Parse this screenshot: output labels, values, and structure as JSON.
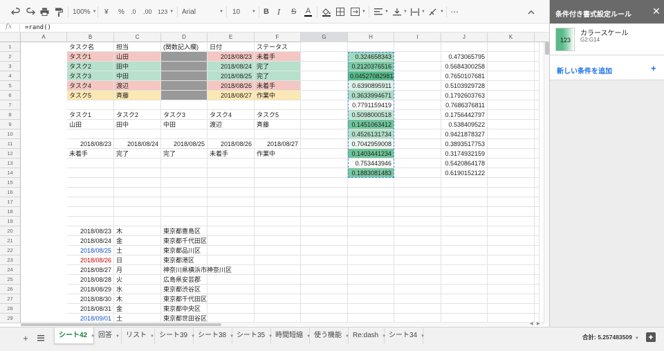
{
  "toolbar": {
    "zoom": "100%",
    "currency": "¥",
    "percent": "%",
    "decimal_decrease": ".0",
    "decimal_increase": ".00",
    "number_format": "123",
    "font": "Arial",
    "font_size": "10",
    "bold": "B",
    "italic": "I",
    "strike": "S",
    "text_color_letter": "A",
    "more": "⋯"
  },
  "formula_bar": {
    "fx": "fx",
    "formula": "=rand()"
  },
  "columns": [
    "A",
    "B",
    "C",
    "D",
    "E",
    "F",
    "G",
    "H",
    "I",
    "J",
    "K"
  ],
  "rows": [
    {
      "n": "1",
      "cells": [
        {
          "c": 0,
          "t": "タスク名"
        },
        {
          "c": 1,
          "t": "担当"
        },
        {
          "c": 2,
          "t": "(関数記入欄)"
        },
        {
          "c": 3,
          "t": "日付"
        },
        {
          "c": 4,
          "t": "ステータス"
        }
      ]
    },
    {
      "n": "2",
      "cells": [
        {
          "c": 0,
          "t": "タスク1",
          "bg": "red"
        },
        {
          "c": 1,
          "t": "山田",
          "bg": "red"
        },
        {
          "c": 2,
          "t": "",
          "bg": "gray"
        },
        {
          "c": 3,
          "t": "2018/08/23",
          "bg": "red",
          "num": true
        },
        {
          "c": 4,
          "t": "未着手",
          "bg": "red"
        },
        {
          "c": 6,
          "t": "0.324658343",
          "num": true,
          "g": 0.56
        },
        {
          "c": 8,
          "t": "0.473065795",
          "num": true
        }
      ]
    },
    {
      "n": "3",
      "cells": [
        {
          "c": 0,
          "t": "タスク2",
          "bg": "green"
        },
        {
          "c": 1,
          "t": "田中",
          "bg": "green"
        },
        {
          "c": 2,
          "t": "",
          "bg": "gray"
        },
        {
          "c": 3,
          "t": "2018/08/24",
          "bg": "green",
          "num": true
        },
        {
          "c": 4,
          "t": "完了",
          "bg": "green"
        },
        {
          "c": 6,
          "t": "0.2120376516",
          "num": true,
          "g": 0.77
        },
        {
          "c": 8,
          "t": "0.5684300258",
          "num": true
        }
      ]
    },
    {
      "n": "4",
      "cells": [
        {
          "c": 0,
          "t": "タスク3",
          "bg": "green"
        },
        {
          "c": 1,
          "t": "中田",
          "bg": "green"
        },
        {
          "c": 2,
          "t": "",
          "bg": "gray"
        },
        {
          "c": 3,
          "t": "2018/08/25",
          "bg": "green",
          "num": true
        },
        {
          "c": 4,
          "t": "完了",
          "bg": "green"
        },
        {
          "c": 6,
          "t": "0.04527082981",
          "num": true,
          "g": 1.0
        },
        {
          "c": 8,
          "t": "0.7650107681",
          "num": true
        }
      ]
    },
    {
      "n": "5",
      "cells": [
        {
          "c": 0,
          "t": "タスク4",
          "bg": "red"
        },
        {
          "c": 1,
          "t": "渡辺",
          "bg": "red"
        },
        {
          "c": 2,
          "t": "",
          "bg": "gray"
        },
        {
          "c": 3,
          "t": "2018/08/26",
          "bg": "red",
          "num": true
        },
        {
          "c": 4,
          "t": "未着手",
          "bg": "red"
        },
        {
          "c": 6,
          "t": "0.6390895911",
          "num": true,
          "g": 0.2
        },
        {
          "c": 8,
          "t": "0.5103929728",
          "num": true
        }
      ]
    },
    {
      "n": "6",
      "cells": [
        {
          "c": 0,
          "t": "タスク5",
          "bg": "yellow"
        },
        {
          "c": 1,
          "t": "斉藤",
          "bg": "yellow"
        },
        {
          "c": 2,
          "t": "",
          "bg": "gray"
        },
        {
          "c": 3,
          "t": "2018/08/27",
          "bg": "yellow",
          "num": true
        },
        {
          "c": 4,
          "t": "作業中",
          "bg": "yellow"
        },
        {
          "c": 6,
          "t": "0.3633994671",
          "num": true,
          "g": 0.5
        },
        {
          "c": 8,
          "t": "0.1792603763",
          "num": true
        }
      ]
    },
    {
      "n": "7",
      "cells": [
        {
          "c": 6,
          "t": "0.7791159419",
          "num": true,
          "g": 0.0
        },
        {
          "c": 8,
          "t": "0.7686376811",
          "num": true
        }
      ]
    },
    {
      "n": "8",
      "cells": [
        {
          "c": 0,
          "t": "タスク1"
        },
        {
          "c": 1,
          "t": "タスク2"
        },
        {
          "c": 2,
          "t": "タスク3"
        },
        {
          "c": 3,
          "t": "タスク4"
        },
        {
          "c": 4,
          "t": "タスク5"
        },
        {
          "c": 6,
          "t": "0.5098000518",
          "num": true,
          "g": 0.37
        },
        {
          "c": 8,
          "t": "0.1756442797",
          "num": true
        }
      ]
    },
    {
      "n": "9",
      "cells": [
        {
          "c": 0,
          "t": "山田"
        },
        {
          "c": 1,
          "t": "田中"
        },
        {
          "c": 2,
          "t": "中田"
        },
        {
          "c": 3,
          "t": "渡辺"
        },
        {
          "c": 4,
          "t": "斉藤"
        },
        {
          "c": 6,
          "t": "0.1451063412",
          "num": true,
          "g": 0.86
        },
        {
          "c": 8,
          "t": "0.538409522",
          "num": true
        }
      ]
    },
    {
      "n": "10",
      "cells": [
        {
          "c": 6,
          "t": "0.4526131734",
          "num": true,
          "g": 0.45
        },
        {
          "c": 8,
          "t": "0.9421878327",
          "num": true
        }
      ]
    },
    {
      "n": "11",
      "cells": [
        {
          "c": 0,
          "t": "2018/08/23",
          "num": true
        },
        {
          "c": 1,
          "t": "2018/08/24",
          "num": true
        },
        {
          "c": 2,
          "t": "2018/08/25",
          "num": true
        },
        {
          "c": 3,
          "t": "2018/08/26",
          "num": true
        },
        {
          "c": 4,
          "t": "2018/08/27",
          "num": true
        },
        {
          "c": 6,
          "t": "0.7042959008",
          "num": true,
          "g": 0.1
        },
        {
          "c": 8,
          "t": "0.3893517753",
          "num": true
        }
      ]
    },
    {
      "n": "12",
      "cells": [
        {
          "c": 0,
          "t": "未着手"
        },
        {
          "c": 1,
          "t": "完了"
        },
        {
          "c": 2,
          "t": "完了"
        },
        {
          "c": 3,
          "t": "未着手"
        },
        {
          "c": 4,
          "t": "作業中"
        },
        {
          "c": 6,
          "t": "0.1403441234",
          "num": true,
          "g": 0.87
        },
        {
          "c": 8,
          "t": "0.3174932159",
          "num": true
        }
      ]
    },
    {
      "n": "13",
      "cells": [
        {
          "c": 6,
          "t": "0.753443946",
          "num": true,
          "g": 0.03
        },
        {
          "c": 8,
          "t": "0.5420864178",
          "num": true
        }
      ]
    },
    {
      "n": "14",
      "cells": [
        {
          "c": 6,
          "t": "0.1883081483",
          "num": true,
          "g": 0.8
        },
        {
          "c": 8,
          "t": "0.6190152122",
          "num": true
        }
      ]
    },
    {
      "n": "15",
      "cells": []
    },
    {
      "n": "16",
      "cells": []
    },
    {
      "n": "17",
      "cells": []
    },
    {
      "n": "18",
      "cells": []
    },
    {
      "n": "19",
      "cells": []
    },
    {
      "n": "20",
      "cells": [
        {
          "c": 0,
          "t": "2018/08/23",
          "num": true
        },
        {
          "c": 1,
          "t": "木"
        },
        {
          "c": 2,
          "t": "東京都豊島区"
        }
      ]
    },
    {
      "n": "21",
      "cells": [
        {
          "c": 0,
          "t": "2018/08/24",
          "num": true
        },
        {
          "c": 1,
          "t": "金"
        },
        {
          "c": 2,
          "t": "東京都千代田区"
        }
      ]
    },
    {
      "n": "22",
      "cells": [
        {
          "c": 0,
          "t": "2018/08/25",
          "num": true,
          "fg": "blue"
        },
        {
          "c": 1,
          "t": "土"
        },
        {
          "c": 2,
          "t": "東京都品川区"
        }
      ]
    },
    {
      "n": "23",
      "cells": [
        {
          "c": 0,
          "t": "2018/08/26",
          "num": true,
          "fg": "red"
        },
        {
          "c": 1,
          "t": "日"
        },
        {
          "c": 2,
          "t": "東京都港区"
        }
      ]
    },
    {
      "n": "24",
      "cells": [
        {
          "c": 0,
          "t": "2018/08/27",
          "num": true
        },
        {
          "c": 1,
          "t": "月"
        },
        {
          "c": 2,
          "t": "神奈川県横浜市神奈川区"
        }
      ]
    },
    {
      "n": "25",
      "cells": [
        {
          "c": 0,
          "t": "2018/08/28",
          "num": true
        },
        {
          "c": 1,
          "t": "火"
        },
        {
          "c": 2,
          "t": "広島県安芸郡"
        }
      ]
    },
    {
      "n": "26",
      "cells": [
        {
          "c": 0,
          "t": "2018/08/29",
          "num": true
        },
        {
          "c": 1,
          "t": "水"
        },
        {
          "c": 2,
          "t": "東京都渋谷区"
        }
      ]
    },
    {
      "n": "27",
      "cells": [
        {
          "c": 0,
          "t": "2018/08/30",
          "num": true
        },
        {
          "c": 1,
          "t": "木"
        },
        {
          "c": 2,
          "t": "東京都千代田区"
        }
      ]
    },
    {
      "n": "28",
      "cells": [
        {
          "c": 0,
          "t": "2018/08/31",
          "num": true
        },
        {
          "c": 1,
          "t": "金"
        },
        {
          "c": 2,
          "t": "東京都中央区"
        }
      ]
    },
    {
      "n": "29",
      "cells": [
        {
          "c": 0,
          "t": "2018/09/01",
          "num": true,
          "fg": "blue"
        },
        {
          "c": 1,
          "t": "土"
        },
        {
          "c": 2,
          "t": "東京都世田谷区"
        }
      ]
    }
  ],
  "colors": {
    "red": "#f4c7c3",
    "green": "#b7e1cd",
    "yellow": "#fce8b2",
    "gray": "#999999",
    "blue_text": "#1155cc",
    "red_text": "#cc0000",
    "scale_min": "#57bb8a",
    "scale_max": "#ffffff",
    "selection": "#4285f4",
    "active_tab": "#188038",
    "link": "#1a73e8"
  },
  "tabs": [
    "シート42",
    "回答",
    "リスト",
    "シート39",
    "シート38",
    "シート35",
    "時間短縮",
    "使う機能",
    "Re:dash",
    "シート34"
  ],
  "active_tab": "シート42",
  "status": {
    "sum": "合計: 5.257483509"
  },
  "panel": {
    "title": "条件付き書式設定ルール",
    "rule_preview": "123",
    "rule_name": "カラースケール",
    "rule_range": "G2:G14",
    "add_rule": "新しい条件を追加"
  }
}
